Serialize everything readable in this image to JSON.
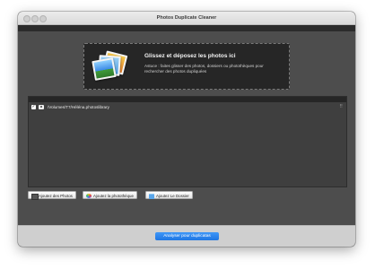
{
  "window": {
    "title": "Photos Duplicate Cleaner"
  },
  "dropzone": {
    "title": "Glissez et déposez les photos ici",
    "description": "Astuce : faites glisser des photos, dossiers ou photothèques pour rechercher des photos dupliquées",
    "icon": "photos-stack-icon"
  },
  "list": {
    "items": [
      {
        "checked": true,
        "check_glyph": "✓",
        "icon": "photo-library-icon",
        "path": "/Volumes/T7/Héléna.photoslibrary",
        "menu_glyph": "⠿"
      }
    ]
  },
  "buttons": {
    "add_photos": "Ajoutez des Photos",
    "add_library": "Ajoutez la photothèque",
    "add_folder": "Ajoutez Le Dossier"
  },
  "footer": {
    "analyze": "Analyser pour duplicatas"
  },
  "colors": {
    "accent": "#2a84ef",
    "window_bg": "#4d4d4d",
    "panel_bg": "#262626"
  }
}
